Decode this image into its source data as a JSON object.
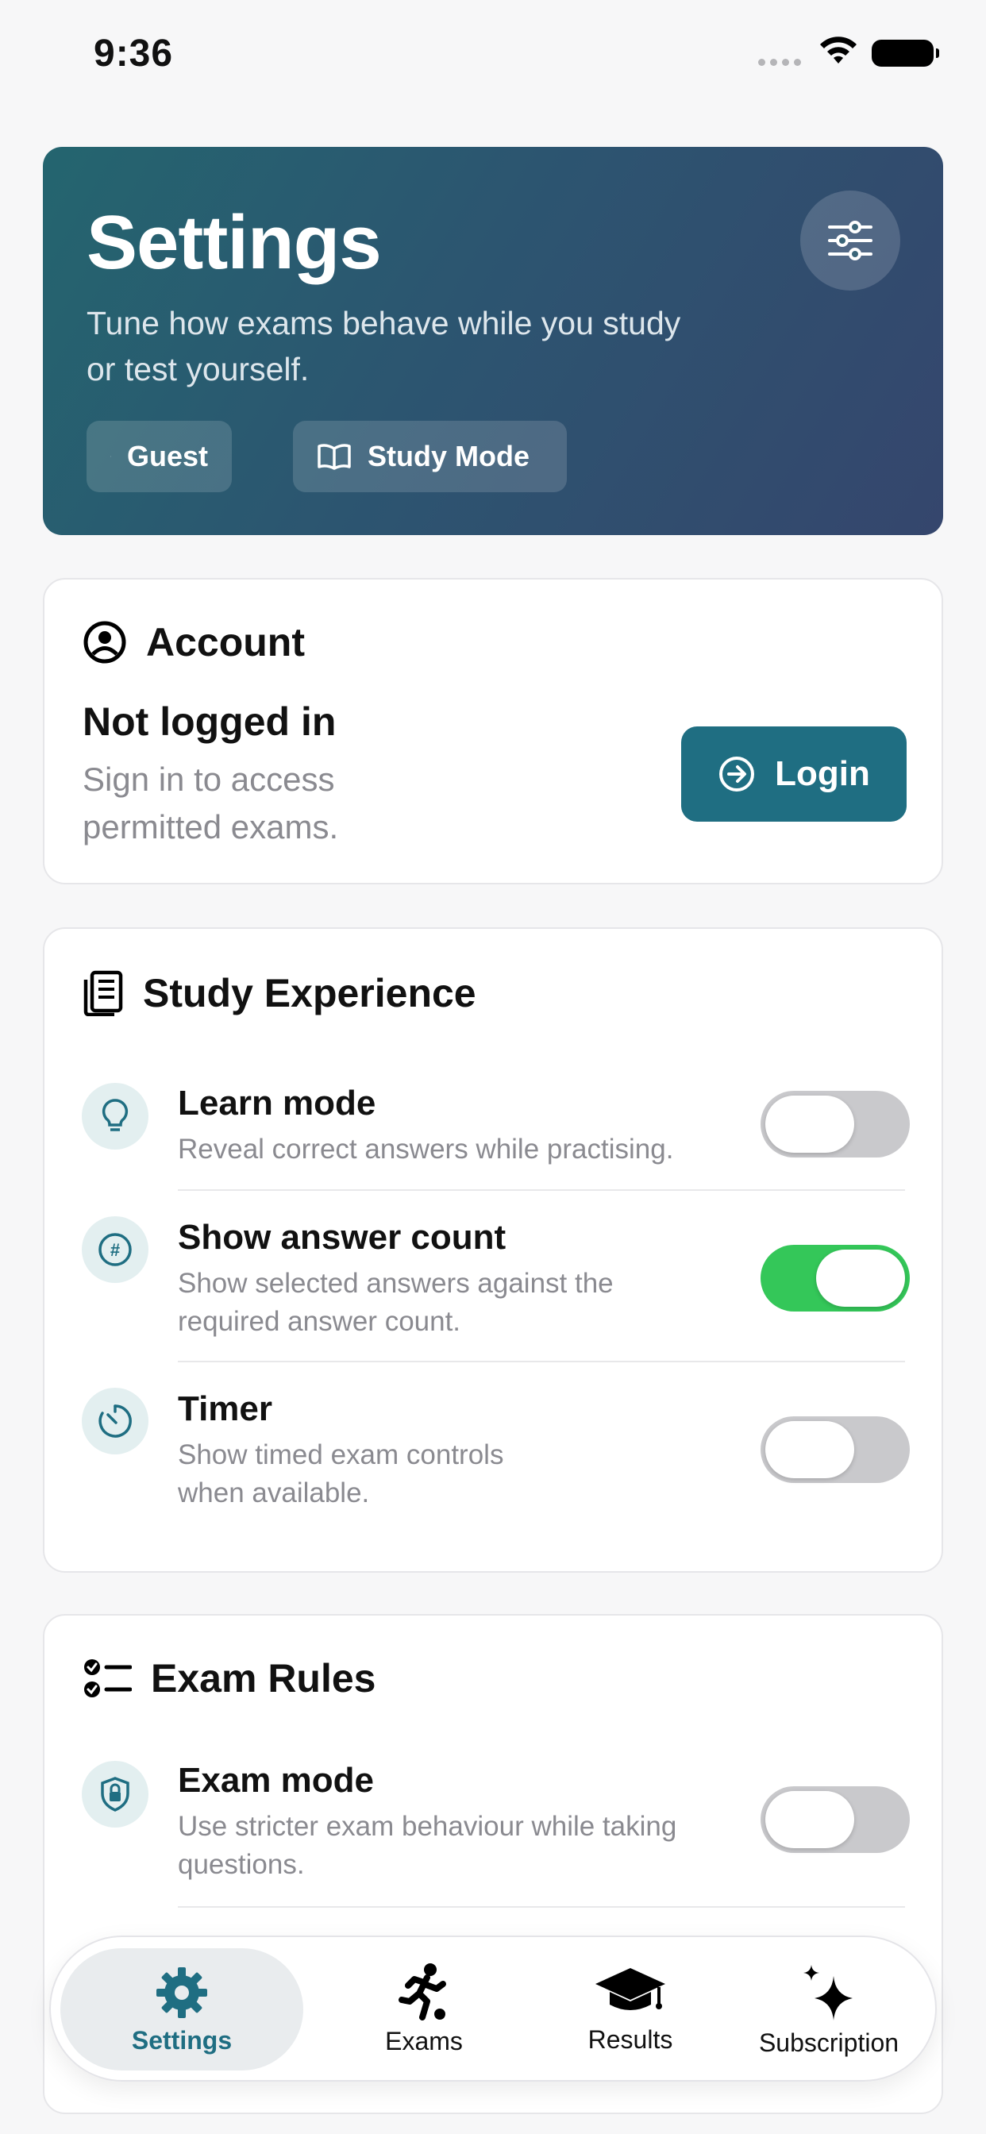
{
  "status_bar": {
    "time": "9:36"
  },
  "hero": {
    "title": "Settings",
    "subtitle": "Tune how exams behave while you study or test yourself.",
    "chips": {
      "guest": "Guest",
      "study_mode": "Study Mode"
    }
  },
  "account": {
    "title": "Account",
    "status": "Not logged in",
    "description": "Sign in to access permitted exams.",
    "login_label": "Login"
  },
  "study": {
    "title": "Study Experience",
    "rows": [
      {
        "title": "Learn mode",
        "description": "Reveal correct answers while practising.",
        "enabled": false
      },
      {
        "title": "Show answer count",
        "description": "Show selected answers against the required answer count.",
        "enabled": true
      },
      {
        "title": "Timer",
        "description": "Show timed exam controls when available.",
        "enabled": false
      }
    ]
  },
  "exam_rules": {
    "title": "Exam Rules",
    "rows": [
      {
        "title": "Exam mode",
        "description": "Use stricter exam behaviour while taking questions.",
        "enabled": false
      }
    ]
  },
  "tabbar": {
    "tabs": [
      {
        "label": "Settings",
        "active": true
      },
      {
        "label": "Exams",
        "active": false
      },
      {
        "label": "Results",
        "active": false
      },
      {
        "label": "Subscription",
        "active": false
      }
    ]
  },
  "colors": {
    "accent": "#1f6e82",
    "toggle_on": "#34c759",
    "toggle_off": "#c9c9cc"
  }
}
